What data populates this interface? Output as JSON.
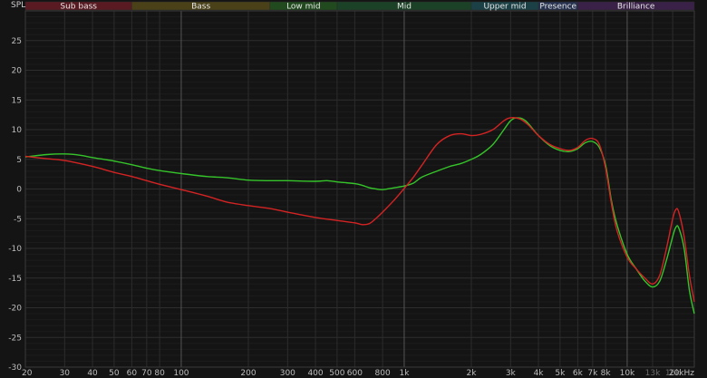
{
  "chart_data": {
    "type": "line",
    "ylabel": "SPL",
    "xscale": "log",
    "xlim": [
      20,
      20000
    ],
    "ylim": [
      -30,
      30
    ],
    "grid": true,
    "y_ticks": [
      25,
      20,
      15,
      10,
      5,
      0,
      -5,
      -10,
      -15,
      -20,
      -25,
      -30
    ],
    "x_ticks": [
      {
        "value": 20,
        "label": "20",
        "major": false,
        "dim": false
      },
      {
        "value": 30,
        "label": "30",
        "major": false,
        "dim": false
      },
      {
        "value": 40,
        "label": "40",
        "major": false,
        "dim": false
      },
      {
        "value": 50,
        "label": "50",
        "major": false,
        "dim": false
      },
      {
        "value": 60,
        "label": "60",
        "major": false,
        "dim": false
      },
      {
        "value": 70,
        "label": "70",
        "major": false,
        "dim": false
      },
      {
        "value": 80,
        "label": "80",
        "major": false,
        "dim": false
      },
      {
        "value": 100,
        "label": "100",
        "major": true,
        "dim": false
      },
      {
        "value": 200,
        "label": "200",
        "major": false,
        "dim": false
      },
      {
        "value": 300,
        "label": "300",
        "major": false,
        "dim": false
      },
      {
        "value": 400,
        "label": "400",
        "major": false,
        "dim": false
      },
      {
        "value": 500,
        "label": "500",
        "major": false,
        "dim": false
      },
      {
        "value": 600,
        "label": "600",
        "major": false,
        "dim": false
      },
      {
        "value": 800,
        "label": "800",
        "major": false,
        "dim": false
      },
      {
        "value": 1000,
        "label": "1k",
        "major": true,
        "dim": false
      },
      {
        "value": 2000,
        "label": "2k",
        "major": false,
        "dim": false
      },
      {
        "value": 3000,
        "label": "3k",
        "major": false,
        "dim": false
      },
      {
        "value": 4000,
        "label": "4k",
        "major": false,
        "dim": false
      },
      {
        "value": 5000,
        "label": "5k",
        "major": false,
        "dim": false
      },
      {
        "value": 6000,
        "label": "6k",
        "major": false,
        "dim": false
      },
      {
        "value": 7000,
        "label": "7k",
        "major": false,
        "dim": false
      },
      {
        "value": 8000,
        "label": "8k",
        "major": false,
        "dim": false
      },
      {
        "value": 10000,
        "label": "10k",
        "major": true,
        "dim": false
      },
      {
        "value": 13000,
        "label": "13k",
        "major": false,
        "dim": true
      },
      {
        "value": 16000,
        "label": "16k",
        "major": false,
        "dim": true
      },
      {
        "value": 20000,
        "label": "20kHz",
        "major": false,
        "dim": false
      }
    ],
    "bands": [
      {
        "label": "Sub bass",
        "from": 20,
        "to": 60,
        "color": "#5a1a22"
      },
      {
        "label": "Bass",
        "from": 60,
        "to": 250,
        "color": "#4a4118"
      },
      {
        "label": "Low mid",
        "from": 250,
        "to": 500,
        "color": "#214a1f"
      },
      {
        "label": "Mid",
        "from": 500,
        "to": 2000,
        "color": "#1b4226"
      },
      {
        "label": "Upper mid",
        "from": 2000,
        "to": 4000,
        "color": "#1b4146"
      },
      {
        "label": "Presence",
        "from": 4000,
        "to": 6000,
        "color": "#26324f"
      },
      {
        "label": "Brilliance",
        "from": 6000,
        "to": 20000,
        "color": "#3a2148"
      }
    ],
    "series": [
      {
        "color": "#35c42a",
        "points": [
          [
            20,
            5.4
          ],
          [
            25,
            5.8
          ],
          [
            30,
            5.9
          ],
          [
            35,
            5.7
          ],
          [
            40,
            5.3
          ],
          [
            50,
            4.7
          ],
          [
            60,
            4.1
          ],
          [
            70,
            3.5
          ],
          [
            80,
            3.1
          ],
          [
            100,
            2.6
          ],
          [
            130,
            2.1
          ],
          [
            160,
            1.9
          ],
          [
            200,
            1.5
          ],
          [
            250,
            1.4
          ],
          [
            300,
            1.4
          ],
          [
            400,
            1.3
          ],
          [
            450,
            1.4
          ],
          [
            500,
            1.2
          ],
          [
            600,
            0.9
          ],
          [
            650,
            0.6
          ],
          [
            700,
            0.2
          ],
          [
            750,
            0
          ],
          [
            800,
            -0.1
          ],
          [
            900,
            0.2
          ],
          [
            1000,
            0.5
          ],
          [
            1100,
            1.0
          ],
          [
            1200,
            2.0
          ],
          [
            1400,
            3.0
          ],
          [
            1600,
            3.8
          ],
          [
            1800,
            4.3
          ],
          [
            2000,
            5.0
          ],
          [
            2200,
            5.8
          ],
          [
            2500,
            7.5
          ],
          [
            2800,
            10.0
          ],
          [
            3000,
            11.5
          ],
          [
            3200,
            12.0
          ],
          [
            3500,
            11.5
          ],
          [
            4000,
            9.0
          ],
          [
            4500,
            7.3
          ],
          [
            5000,
            6.5
          ],
          [
            5500,
            6.3
          ],
          [
            6000,
            6.8
          ],
          [
            6500,
            7.8
          ],
          [
            7000,
            8.0
          ],
          [
            7500,
            7.0
          ],
          [
            8000,
            4.0
          ],
          [
            8500,
            -2.0
          ],
          [
            9000,
            -6.0
          ],
          [
            10000,
            -11.0
          ],
          [
            11000,
            -13.5
          ],
          [
            12000,
            -15.5
          ],
          [
            13000,
            -16.5
          ],
          [
            14000,
            -15.5
          ],
          [
            15000,
            -12.0
          ],
          [
            16000,
            -8.0
          ],
          [
            16500,
            -6.5
          ],
          [
            17000,
            -6.5
          ],
          [
            18000,
            -10.0
          ],
          [
            19000,
            -17.0
          ],
          [
            20000,
            -21.0
          ]
        ]
      },
      {
        "color": "#d42323",
        "points": [
          [
            20,
            5.5
          ],
          [
            25,
            5.1
          ],
          [
            30,
            4.8
          ],
          [
            40,
            3.8
          ],
          [
            50,
            2.8
          ],
          [
            60,
            2.1
          ],
          [
            70,
            1.4
          ],
          [
            80,
            0.8
          ],
          [
            100,
            -0.1
          ],
          [
            130,
            -1.2
          ],
          [
            160,
            -2.2
          ],
          [
            200,
            -2.8
          ],
          [
            250,
            -3.3
          ],
          [
            300,
            -3.9
          ],
          [
            400,
            -4.8
          ],
          [
            500,
            -5.3
          ],
          [
            600,
            -5.7
          ],
          [
            650,
            -6.0
          ],
          [
            700,
            -5.8
          ],
          [
            750,
            -4.9
          ],
          [
            800,
            -3.9
          ],
          [
            900,
            -1.9
          ],
          [
            1000,
            0.1
          ],
          [
            1100,
            2.0
          ],
          [
            1200,
            4.0
          ],
          [
            1400,
            7.5
          ],
          [
            1600,
            9.0
          ],
          [
            1800,
            9.3
          ],
          [
            2000,
            9.0
          ],
          [
            2200,
            9.2
          ],
          [
            2500,
            10.0
          ],
          [
            2800,
            11.5
          ],
          [
            3000,
            12.0
          ],
          [
            3300,
            11.8
          ],
          [
            3600,
            10.8
          ],
          [
            4000,
            9.0
          ],
          [
            4500,
            7.5
          ],
          [
            5000,
            6.8
          ],
          [
            5500,
            6.5
          ],
          [
            6000,
            7.0
          ],
          [
            6500,
            8.2
          ],
          [
            7000,
            8.5
          ],
          [
            7500,
            7.5
          ],
          [
            8000,
            3.5
          ],
          [
            8500,
            -2.5
          ],
          [
            9000,
            -7.0
          ],
          [
            10000,
            -11.5
          ],
          [
            11000,
            -13.5
          ],
          [
            12000,
            -15.0
          ],
          [
            13000,
            -16.0
          ],
          [
            14000,
            -14.5
          ],
          [
            15000,
            -10.0
          ],
          [
            16000,
            -5.0
          ],
          [
            16500,
            -3.5
          ],
          [
            17000,
            -3.8
          ],
          [
            18000,
            -8.0
          ],
          [
            19000,
            -14.5
          ],
          [
            20000,
            -19.0
          ]
        ]
      }
    ]
  }
}
